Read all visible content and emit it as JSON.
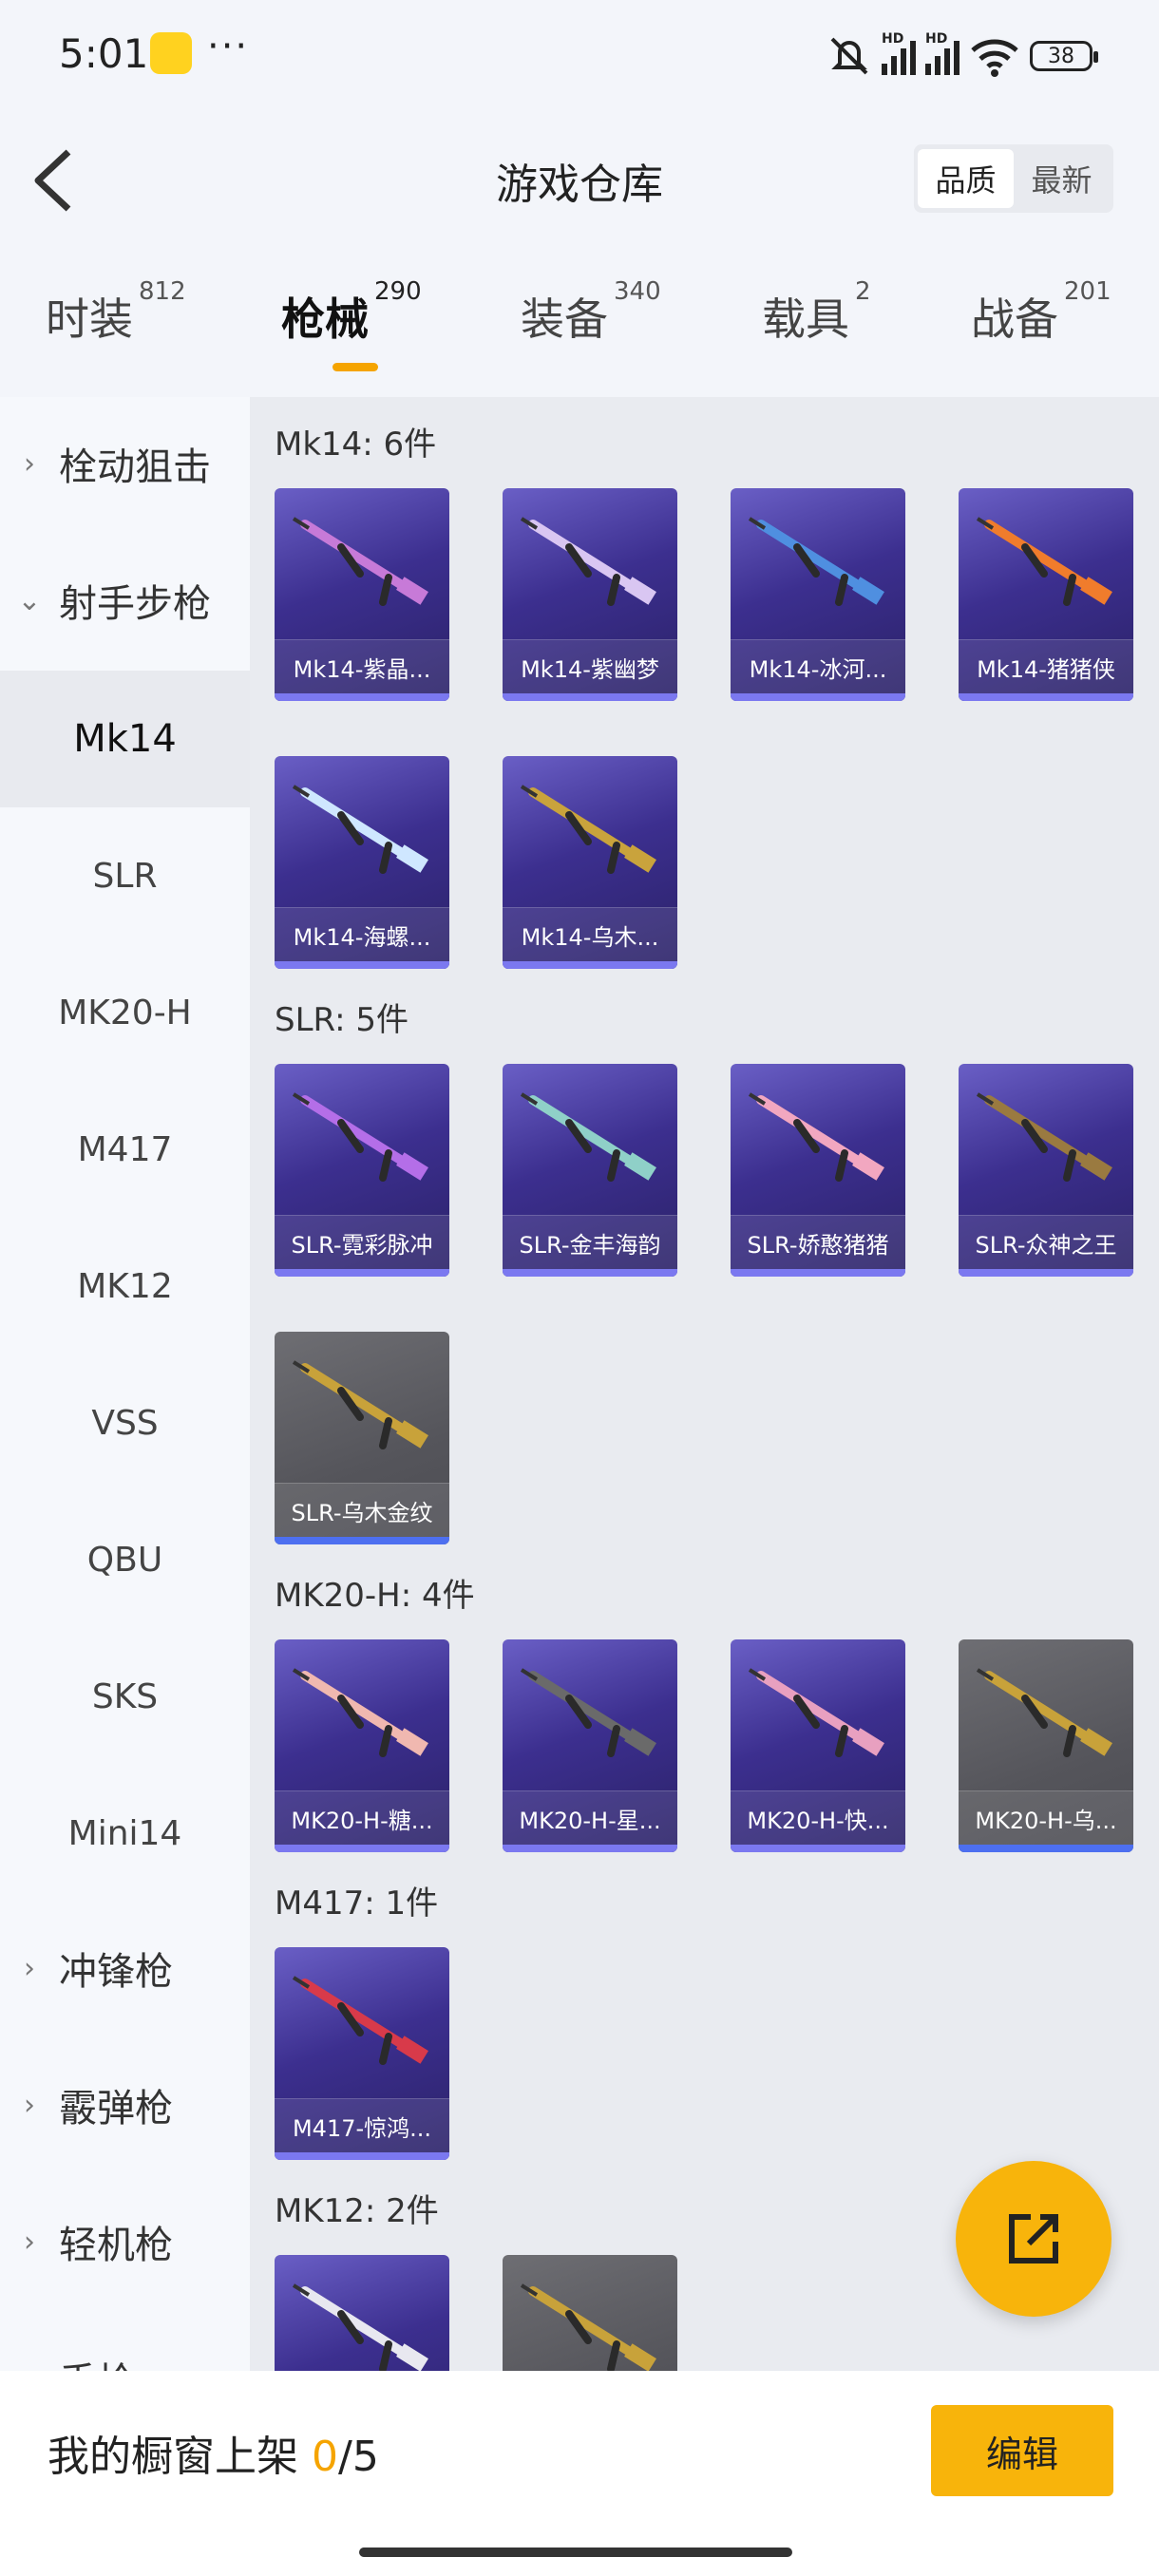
{
  "status_bar": {
    "time": "5:01",
    "more": "···",
    "battery": "38",
    "hd_label": "HD"
  },
  "header": {
    "title": "游戏仓库",
    "sort_options": [
      "品质",
      "最新"
    ],
    "active_sort": "品质"
  },
  "tabs": [
    {
      "label": "时装",
      "count": "812"
    },
    {
      "label": "枪械",
      "count": "290",
      "active": true
    },
    {
      "label": "装备",
      "count": "340"
    },
    {
      "label": "载具",
      "count": "2"
    },
    {
      "label": "战备",
      "count": "201"
    }
  ],
  "sidebar": {
    "cat_sniper": "栓动狙击",
    "cat_marksman": "射手步枪",
    "subs": [
      "Mk14",
      "SLR",
      "MK20-H",
      "M417",
      "MK12",
      "VSS",
      "QBU",
      "SKS",
      "Mini14"
    ],
    "active_sub": "Mk14",
    "cat_smg": "冲锋枪",
    "cat_shotgun": "霰弹枪",
    "cat_lmg": "轻机枪",
    "cat_pistol": "手枪"
  },
  "sections": [
    {
      "title": "Mk14: 6件",
      "items": [
        {
          "name": "Mk14-紫晶...",
          "style": "purple",
          "color": "#c77ad8"
        },
        {
          "name": "Mk14-紫幽梦",
          "style": "purple",
          "color": "#d9c6f2"
        },
        {
          "name": "Mk14-冰河...",
          "style": "purple",
          "color": "#4f8fe0"
        },
        {
          "name": "Mk14-猪猪侠",
          "style": "purple",
          "color": "#f07c2c"
        },
        {
          "name": "Mk14-海螺...",
          "style": "purple",
          "color": "#cfe7ff"
        },
        {
          "name": "Mk14-乌木...",
          "style": "purple",
          "color": "#c9a33c"
        }
      ]
    },
    {
      "title": "SLR: 5件",
      "items": [
        {
          "name": "SLR-霓彩脉冲",
          "style": "purple",
          "color": "#b46ee8"
        },
        {
          "name": "SLR-金丰海韵",
          "style": "purple",
          "color": "#8fd0c8"
        },
        {
          "name": "SLR-娇憨猪猪",
          "style": "purple",
          "color": "#f2a7c0"
        },
        {
          "name": "SLR-众神之王",
          "style": "purple",
          "color": "#9a7a40"
        },
        {
          "name": "SLR-乌木金纹",
          "style": "gray",
          "color": "#c8a23a"
        }
      ]
    },
    {
      "title": "MK20-H: 4件",
      "items": [
        {
          "name": "MK20-H-糖...",
          "style": "purple",
          "color": "#f0b8b0"
        },
        {
          "name": "MK20-H-星...",
          "style": "purple",
          "color": "#6a6a6a"
        },
        {
          "name": "MK20-H-快...",
          "style": "purple",
          "color": "#e8a0c0"
        },
        {
          "name": "MK20-H-乌...",
          "style": "gray",
          "color": "#c8a23a"
        }
      ]
    },
    {
      "title": "M417: 1件",
      "items": [
        {
          "name": "M417-惊鸿...",
          "style": "purple",
          "color": "#d83a4a"
        }
      ]
    },
    {
      "title": "MK12: 2件",
      "items": [
        {
          "name": "",
          "style": "purple",
          "color": "#e8e8f0"
        },
        {
          "name": "",
          "style": "gray",
          "color": "#c8a23a"
        }
      ]
    }
  ],
  "bottom": {
    "showcase_label": "我的橱窗上架",
    "showcase_count": "0",
    "showcase_total": "/5",
    "edit_label": "编辑"
  },
  "icons": {
    "back": "back-chevron-icon",
    "share": "share-external-icon",
    "expand": "chevron-right-icon",
    "collapse": "chevron-down-icon"
  }
}
